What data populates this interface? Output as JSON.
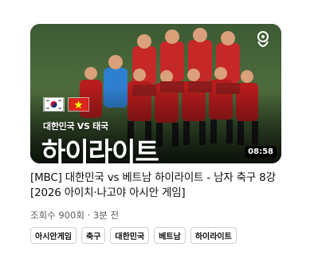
{
  "video": {
    "thumbnail": {
      "subtitle": "대한민국 VS 태국",
      "headline": "하이라이트",
      "duration": "08:58",
      "flags": [
        "south-korea-flag",
        "vietnam-flag"
      ],
      "logo_icon": "tournament-logo-icon"
    },
    "title": "[MBC] 대한민국 vs 베트남 하이라이트 - 남자 축구 8강 [2026 아이치·나고야 아시안 게임]",
    "meta": "조회수 900회 · 3분 전",
    "tags": [
      "아시안게임",
      "축구",
      "대한민국",
      "베트남",
      "하이라이트"
    ]
  },
  "colors": {
    "text_primary": "#0f0f0f",
    "text_secondary": "#606060",
    "tag_border": "#cfcfcf",
    "duration_bg": "#000000"
  }
}
